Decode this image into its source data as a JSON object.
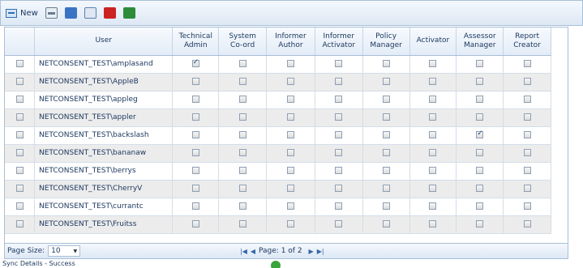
{
  "toolbar": {
    "new_label": "New",
    "icons": [
      "print-icon",
      "word-icon",
      "doc-icon",
      "pdf-icon",
      "excel-icon"
    ]
  },
  "grid": {
    "headers": [
      "User",
      "Technical Admin",
      "System Co-ord",
      "Informer Author",
      "Informer Activator",
      "Policy Manager",
      "Activator",
      "Assessor Manager",
      "Report Creator"
    ],
    "header_lines": [
      [
        "User"
      ],
      [
        "Technical",
        "Admin"
      ],
      [
        "System",
        "Co-ord"
      ],
      [
        "Informer",
        "Author"
      ],
      [
        "Informer",
        "Activator"
      ],
      [
        "Policy",
        "Manager"
      ],
      [
        "Activator"
      ],
      [
        "Assessor",
        "Manager"
      ],
      [
        "Report",
        "Creator"
      ]
    ],
    "rows": [
      {
        "user": "NETCONSENT_TEST\\amplasand",
        "checks": [
          true,
          false,
          false,
          false,
          false,
          false,
          false,
          false
        ]
      },
      {
        "user": "NETCONSENT_TEST\\AppleB",
        "checks": [
          false,
          false,
          false,
          false,
          false,
          false,
          false,
          false
        ]
      },
      {
        "user": "NETCONSENT_TEST\\appleg",
        "checks": [
          false,
          false,
          false,
          false,
          false,
          false,
          false,
          false
        ]
      },
      {
        "user": "NETCONSENT_TEST\\appler",
        "checks": [
          false,
          false,
          false,
          false,
          false,
          false,
          false,
          false
        ]
      },
      {
        "user": "NETCONSENT_TEST\\backslash",
        "checks": [
          false,
          false,
          false,
          false,
          false,
          false,
          true,
          false
        ]
      },
      {
        "user": "NETCONSENT_TEST\\bananaw",
        "checks": [
          false,
          false,
          false,
          false,
          false,
          false,
          false,
          false
        ]
      },
      {
        "user": "NETCONSENT_TEST\\berrys",
        "checks": [
          false,
          false,
          false,
          false,
          false,
          false,
          false,
          false
        ]
      },
      {
        "user": "NETCONSENT_TEST\\CherryV",
        "checks": [
          false,
          false,
          false,
          false,
          false,
          false,
          false,
          false
        ]
      },
      {
        "user": "NETCONSENT_TEST\\currantc",
        "checks": [
          false,
          false,
          false,
          false,
          false,
          false,
          false,
          false
        ]
      },
      {
        "user": "NETCONSENT_TEST\\Fruitss",
        "checks": [
          false,
          false,
          false,
          false,
          false,
          false,
          false,
          false
        ]
      }
    ]
  },
  "pager": {
    "page_size_label": "Page Size:",
    "page_size_value": "10",
    "page_info": "Page: 1 of 2"
  },
  "status": {
    "text": "Sync Details - Success"
  }
}
